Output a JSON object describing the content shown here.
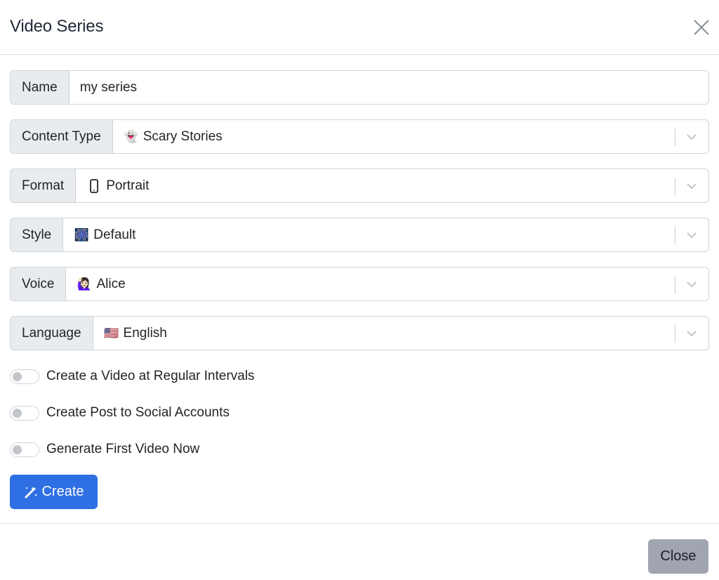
{
  "header": {
    "title": "Video Series",
    "close_icon": "x-icon"
  },
  "form": {
    "name": {
      "label": "Name",
      "value": "my series"
    },
    "content_type": {
      "label": "Content Type",
      "icon": "👻",
      "value": "Scary Stories"
    },
    "format": {
      "label": "Format",
      "icon": "phone-portrait-icon",
      "value": "Portrait"
    },
    "style": {
      "label": "Style",
      "icon": "🎆",
      "value": "Default"
    },
    "voice": {
      "label": "Voice",
      "icon": "🙋🏻‍♀️",
      "value": "Alice"
    },
    "language": {
      "label": "Language",
      "icon": "🇺🇸",
      "value": "English"
    }
  },
  "toggles": [
    {
      "label": "Create a Video at Regular Intervals",
      "checked": false
    },
    {
      "label": "Create Post to Social Accounts",
      "checked": false
    },
    {
      "label": "Generate First Video Now",
      "checked": false
    }
  ],
  "actions": {
    "create_label": "Create",
    "close_label": "Close"
  },
  "colors": {
    "primary": "#2f6fe4",
    "secondary": "#a0a5b0"
  }
}
